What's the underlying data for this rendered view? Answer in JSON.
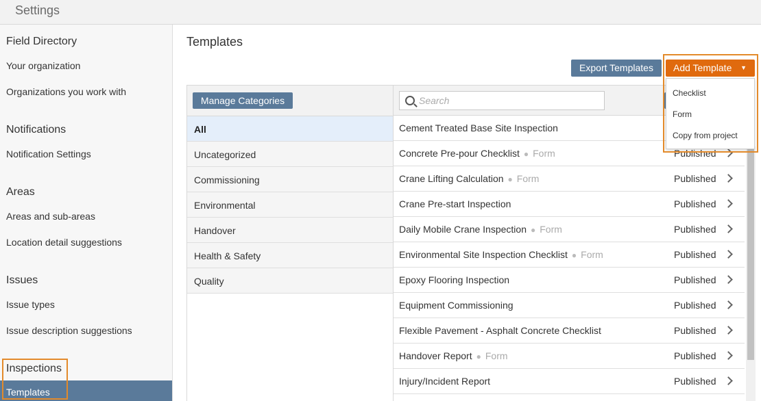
{
  "app": {
    "title": "Settings"
  },
  "sidebar": {
    "sections": [
      {
        "heading": "Field Directory",
        "items": [
          "Your organization",
          "Organizations you work with"
        ]
      },
      {
        "heading": "Notifications",
        "items": [
          "Notification Settings"
        ]
      },
      {
        "heading": "Areas",
        "items": [
          "Areas and sub-areas",
          "Location detail suggestions"
        ]
      },
      {
        "heading": "Issues",
        "items": [
          "Issue types",
          "Issue description suggestions"
        ]
      },
      {
        "heading": "Inspections",
        "items": [
          "Templates"
        ]
      }
    ],
    "active_item": "Templates"
  },
  "main": {
    "title": "Templates",
    "export_label": "Export Templates",
    "add_label": "Add Template",
    "add_caret": "▼",
    "add_menu": [
      "Checklist",
      "Form",
      "Copy from project"
    ],
    "manage_categories_label": "Manage Categories",
    "search_placeholder": "Search",
    "categories": [
      "All",
      "Uncategorized",
      "Commissioning",
      "Environmental",
      "Handover",
      "Health & Safety",
      "Quality"
    ],
    "active_category": "All",
    "templates": [
      {
        "name": "Cement Treated Base Site Inspection",
        "type": "",
        "status": ""
      },
      {
        "name": "Concrete Pre-pour Checklist",
        "type": "Form",
        "status": "Published"
      },
      {
        "name": "Crane Lifting Calculation",
        "type": "Form",
        "status": "Published"
      },
      {
        "name": "Crane Pre-start Inspection",
        "type": "",
        "status": "Published"
      },
      {
        "name": "Daily Mobile Crane Inspection",
        "type": "Form",
        "status": "Published"
      },
      {
        "name": "Environmental Site Inspection Checklist",
        "type": "Form",
        "status": "Published"
      },
      {
        "name": "Epoxy Flooring Inspection",
        "type": "",
        "status": "Published"
      },
      {
        "name": "Equipment Commissioning",
        "type": "",
        "status": "Published"
      },
      {
        "name": "Flexible Pavement - Asphalt Concrete Checklist",
        "type": "",
        "status": "Published"
      },
      {
        "name": "Handover Report",
        "type": "Form",
        "status": "Published"
      },
      {
        "name": "Injury/Incident Report",
        "type": "",
        "status": "Published"
      }
    ]
  },
  "colors": {
    "accent": "#e06a0e",
    "primary": "#5a7a9a",
    "highlight": "#e38a2a",
    "active_category_bg": "#e4eefa"
  }
}
